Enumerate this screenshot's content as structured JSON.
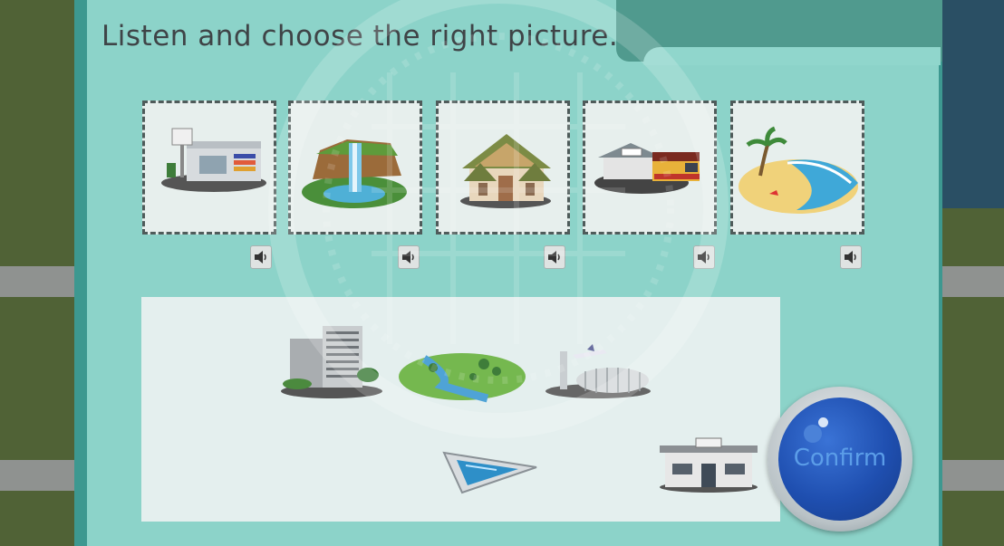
{
  "instruction": "Listen and choose the right picture.",
  "question_cards": [
    {
      "icon": "shopping-mall-icon"
    },
    {
      "icon": "waterfall-icon"
    },
    {
      "icon": "temple-icon"
    },
    {
      "icon": "train-station-icon"
    },
    {
      "icon": "beach-icon"
    }
  ],
  "speaker_icon": "speaker-icon",
  "answer_items": [
    {
      "icon": "hotel-icon"
    },
    {
      "icon": "river-park-icon"
    },
    {
      "icon": "airport-icon"
    },
    {
      "icon": "swimming-pool-icon"
    },
    {
      "icon": "police-station-icon"
    }
  ],
  "confirm_label": "Confirm",
  "colors": {
    "panel": "#3d9890",
    "panel_light": "#90d6cc",
    "card_border": "#4f5b5a",
    "confirm_blue": "#1f4fb0"
  }
}
